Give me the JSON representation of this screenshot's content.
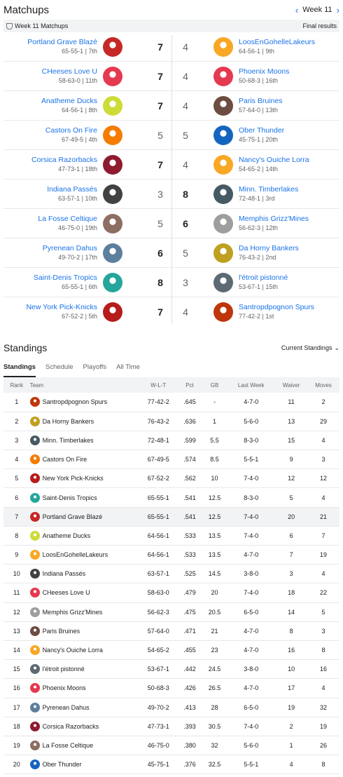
{
  "header": {
    "title": "Matchups",
    "week_label": "Week 11"
  },
  "subheader": {
    "title": "Week 11 Matchups",
    "status": "Final results"
  },
  "matchups": [
    {
      "home": {
        "name": "Portland Grave Blazé",
        "record": "65-55-1 | 7th",
        "color": "#c62828"
      },
      "home_score": "7",
      "away_score": "4",
      "winner": "home",
      "away": {
        "name": "LoosEnGohelleLakeurs",
        "record": "64-56-1 | 9th",
        "color": "#f9a825"
      }
    },
    {
      "home": {
        "name": "CHeeses Love U",
        "record": "58-63-0 | 11th",
        "color": "#e53950"
      },
      "home_score": "7",
      "away_score": "4",
      "winner": "home",
      "away": {
        "name": "Phoenix Moons",
        "record": "50-68-3 | 16th",
        "color": "#e53950"
      }
    },
    {
      "home": {
        "name": "Anatheme Ducks",
        "record": "64-56-1 | 8th",
        "color": "#cddc39"
      },
      "home_score": "7",
      "away_score": "4",
      "winner": "home",
      "away": {
        "name": "Paris Bruines",
        "record": "57-64-0 | 13th",
        "color": "#6d4c41"
      }
    },
    {
      "home": {
        "name": "Castors On Fire",
        "record": "67-49-5 | 4th",
        "color": "#f57c00"
      },
      "home_score": "5",
      "away_score": "5",
      "winner": "tie",
      "away": {
        "name": "Ober Thunder",
        "record": "45-75-1 | 20th",
        "color": "#1565c0"
      }
    },
    {
      "home": {
        "name": "Corsica Razorbacks",
        "record": "47-73-1 | 18th",
        "color": "#8e1b2e"
      },
      "home_score": "7",
      "away_score": "4",
      "winner": "home",
      "away": {
        "name": "Nancy's Ouiche Lorra",
        "record": "54-65-2 | 14th",
        "color": "#f9a825"
      }
    },
    {
      "home": {
        "name": "Indiana Passés",
        "record": "63-57-1 | 10th",
        "color": "#424242"
      },
      "home_score": "3",
      "away_score": "8",
      "winner": "away",
      "away": {
        "name": "Minn. Timberlakes",
        "record": "72-48-1 | 3rd",
        "color": "#455a64"
      }
    },
    {
      "home": {
        "name": "La Fosse Celtique",
        "record": "46-75-0 | 19th",
        "color": "#8d6e63"
      },
      "home_score": "5",
      "away_score": "6",
      "winner": "away",
      "away": {
        "name": "Memphis Grizz'Mines",
        "record": "56-62-3 | 12th",
        "color": "#9e9e9e"
      }
    },
    {
      "home": {
        "name": "Pyrenean Dahus",
        "record": "49-70-2 | 17th",
        "color": "#5d7f9e"
      },
      "home_score": "6",
      "away_score": "5",
      "winner": "home",
      "away": {
        "name": "Da Horny Bankers",
        "record": "76-43-2 | 2nd",
        "color": "#c0a020"
      }
    },
    {
      "home": {
        "name": "Saint-Denis Tropics",
        "record": "65-55-1 | 6th",
        "color": "#26a69a"
      },
      "home_score": "8",
      "away_score": "3",
      "winner": "home",
      "away": {
        "name": "l'étroit pistonné",
        "record": "53-67-1 | 15th",
        "color": "#5c6b73"
      }
    },
    {
      "home": {
        "name": "New York Pick-Knicks",
        "record": "67-52-2 | 5th",
        "color": "#b71c1c"
      },
      "home_score": "7",
      "away_score": "4",
      "winner": "home",
      "away": {
        "name": "Santropdpognon Spurs",
        "record": "77-42-2 | 1st",
        "color": "#bf360c"
      }
    }
  ],
  "standings": {
    "title": "Standings",
    "dropdown_label": "Current Standings",
    "tabs": [
      "Standings",
      "Schedule",
      "Playoffs",
      "All Time"
    ],
    "columns": [
      "Rank",
      "Team",
      "W-L-T",
      "Pct",
      "GB",
      "Last Week",
      "Waiver",
      "Moves"
    ],
    "rows": [
      {
        "rank": "1",
        "team": "Santropdpognon Spurs",
        "wlt": "77-42-2",
        "pct": ".645",
        "gb": "-",
        "last": "4-7-0",
        "waiver": "11",
        "moves": "2",
        "color": "#bf360c"
      },
      {
        "rank": "2",
        "team": "Da Horny Bankers",
        "wlt": "76-43-2",
        "pct": ".636",
        "gb": "1",
        "last": "5-6-0",
        "waiver": "13",
        "moves": "29",
        "color": "#c0a020"
      },
      {
        "rank": "3",
        "team": "Minn. Timberlakes",
        "wlt": "72-48-1",
        "pct": ".599",
        "gb": "5.5",
        "last": "8-3-0",
        "waiver": "15",
        "moves": "4",
        "color": "#455a64"
      },
      {
        "rank": "4",
        "team": "Castors On Fire",
        "wlt": "67-49-5",
        "pct": ".574",
        "gb": "8.5",
        "last": "5-5-1",
        "waiver": "9",
        "moves": "3",
        "color": "#f57c00"
      },
      {
        "rank": "5",
        "team": "New York Pick-Knicks",
        "wlt": "67-52-2",
        "pct": ".562",
        "gb": "10",
        "last": "7-4-0",
        "waiver": "12",
        "moves": "12",
        "color": "#b71c1c"
      },
      {
        "rank": "6",
        "team": "Saint-Denis Tropics",
        "wlt": "65-55-1",
        "pct": ".541",
        "gb": "12.5",
        "last": "8-3-0",
        "waiver": "5",
        "moves": "4",
        "color": "#26a69a"
      },
      {
        "rank": "7",
        "team": "Portland Grave Blazé",
        "wlt": "65-55-1",
        "pct": ".541",
        "gb": "12.5",
        "last": "7-4-0",
        "waiver": "20",
        "moves": "21",
        "color": "#c62828",
        "highlight": true
      },
      {
        "rank": "8",
        "team": "Anatheme Ducks",
        "wlt": "64-56-1",
        "pct": ".533",
        "gb": "13.5",
        "last": "7-4-0",
        "waiver": "6",
        "moves": "7",
        "color": "#cddc39"
      },
      {
        "rank": "9",
        "team": "LoosEnGohelleLakeurs",
        "wlt": "64-56-1",
        "pct": ".533",
        "gb": "13.5",
        "last": "4-7-0",
        "waiver": "7",
        "moves": "19",
        "color": "#f9a825"
      },
      {
        "rank": "10",
        "team": "Indiana Passés",
        "wlt": "63-57-1",
        "pct": ".525",
        "gb": "14.5",
        "last": "3-8-0",
        "waiver": "3",
        "moves": "4",
        "color": "#424242"
      },
      {
        "rank": "11",
        "team": "CHeeses Love U",
        "wlt": "58-63-0",
        "pct": ".479",
        "gb": "20",
        "last": "7-4-0",
        "waiver": "18",
        "moves": "22",
        "color": "#e53950"
      },
      {
        "rank": "12",
        "team": "Memphis Grizz'Mines",
        "wlt": "56-62-3",
        "pct": ".475",
        "gb": "20.5",
        "last": "6-5-0",
        "waiver": "14",
        "moves": "5",
        "color": "#9e9e9e"
      },
      {
        "rank": "13",
        "team": "Paris Bruines",
        "wlt": "57-64-0",
        "pct": ".471",
        "gb": "21",
        "last": "4-7-0",
        "waiver": "8",
        "moves": "3",
        "color": "#6d4c41"
      },
      {
        "rank": "14",
        "team": "Nancy's Ouiche Lorra",
        "wlt": "54-65-2",
        "pct": ".455",
        "gb": "23",
        "last": "4-7-0",
        "waiver": "16",
        "moves": "8",
        "color": "#f9a825"
      },
      {
        "rank": "15",
        "team": "l'étroit pistonné",
        "wlt": "53-67-1",
        "pct": ".442",
        "gb": "24.5",
        "last": "3-8-0",
        "waiver": "10",
        "moves": "16",
        "color": "#5c6b73"
      },
      {
        "rank": "16",
        "team": "Phoenix Moons",
        "wlt": "50-68-3",
        "pct": ".426",
        "gb": "26.5",
        "last": "4-7-0",
        "waiver": "17",
        "moves": "4",
        "color": "#e53950"
      },
      {
        "rank": "17",
        "team": "Pyrenean Dahus",
        "wlt": "49-70-2",
        "pct": ".413",
        "gb": "28",
        "last": "6-5-0",
        "waiver": "19",
        "moves": "32",
        "color": "#5d7f9e"
      },
      {
        "rank": "18",
        "team": "Corsica Razorbacks",
        "wlt": "47-73-1",
        "pct": ".393",
        "gb": "30.5",
        "last": "7-4-0",
        "waiver": "2",
        "moves": "19",
        "color": "#8e1b2e"
      },
      {
        "rank": "19",
        "team": "La Fosse Celtique",
        "wlt": "46-75-0",
        "pct": ".380",
        "gb": "32",
        "last": "5-6-0",
        "waiver": "1",
        "moves": "26",
        "color": "#8d6e63"
      },
      {
        "rank": "20",
        "team": "Ober Thunder",
        "wlt": "45-75-1",
        "pct": ".376",
        "gb": "32.5",
        "last": "5-5-1",
        "waiver": "4",
        "moves": "8",
        "color": "#1565c0"
      }
    ]
  },
  "colors": {
    "link": "#1a73e8",
    "header_bg": "#f1f3f4"
  }
}
